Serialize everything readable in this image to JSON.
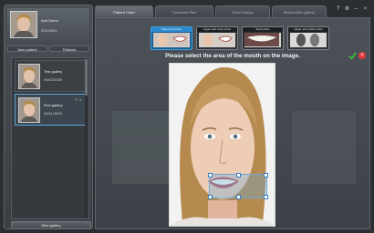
{
  "patient": {
    "name": "Ann Demo",
    "id": "00123001"
  },
  "left_tabs": [
    "New patient",
    "Patients"
  ],
  "galleries": [
    {
      "name": "Test gallery",
      "date": "09/02/2009",
      "selected": false
    },
    {
      "name": "First gallery",
      "date": "03/11/2009",
      "selected": true
    }
  ],
  "new_gallery_label": "New gallery",
  "main_tabs": [
    {
      "label": "Patient Chart",
      "active": true
    },
    {
      "label": "Treatment Plan",
      "active": false
    },
    {
      "label": "Smile Design",
      "active": false
    },
    {
      "label": "Before/After gallery",
      "active": false
    }
  ],
  "window_controls": [
    "?",
    "⚙",
    "–",
    "×"
  ],
  "photo_types": [
    {
      "label": "Diagnostic photo",
      "active": true
    },
    {
      "label": "Upper and smile photo",
      "active": false
    },
    {
      "label": "Teeth photo",
      "active": false
    },
    {
      "label": "Upper and profile photo",
      "active": false
    }
  ],
  "instruction": "Please select the area of the mouth on the image.",
  "icons": {
    "ok": "check-icon",
    "cancel": "close-icon"
  },
  "colors": {
    "accent": "#3aa0de",
    "ok": "#3fbf3f",
    "cancel": "#e33b3b",
    "selection": "#6ea8d8"
  }
}
